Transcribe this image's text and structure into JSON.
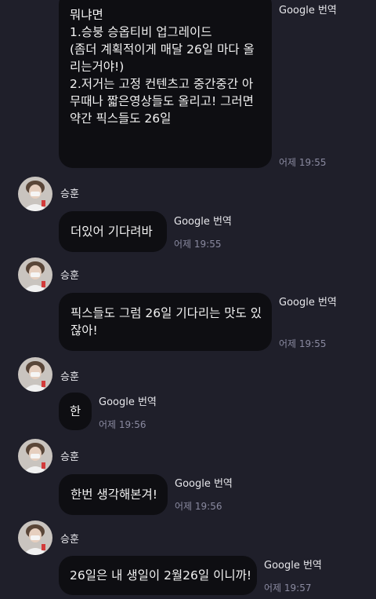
{
  "translate_label": "Google 번역",
  "sender_name": "승훈",
  "messages": [
    {
      "lines": [
        "뭐냐면",
        "",
        "1.승붕 승옵티비 업그레이드",
        "(좀더 계획적이게 매달 26일 마다 올",
        "리는거야!)",
        "2.저거는 고정 컨텐츠고 중간중간 아",
        "무때나 짧은영상들도 올리고! 그러면",
        "약간 픽스들도 26일"
      ],
      "time": "어제 19:55"
    },
    {
      "lines": [
        "더있어 기다려바"
      ],
      "time": "어제 19:55"
    },
    {
      "lines": [
        "픽스들도 그럼 26일 기다리는 맛도 있",
        "잖아!"
      ],
      "time": "어제 19:55"
    },
    {
      "lines": [
        "한"
      ],
      "time": "어제 19:56"
    },
    {
      "lines": [
        "한번 생각해본겨!"
      ],
      "time": "어제 19:56"
    },
    {
      "lines": [
        "26일은 내 생일이 2월26일 이니까!"
      ],
      "time": "어제 19:57"
    }
  ]
}
